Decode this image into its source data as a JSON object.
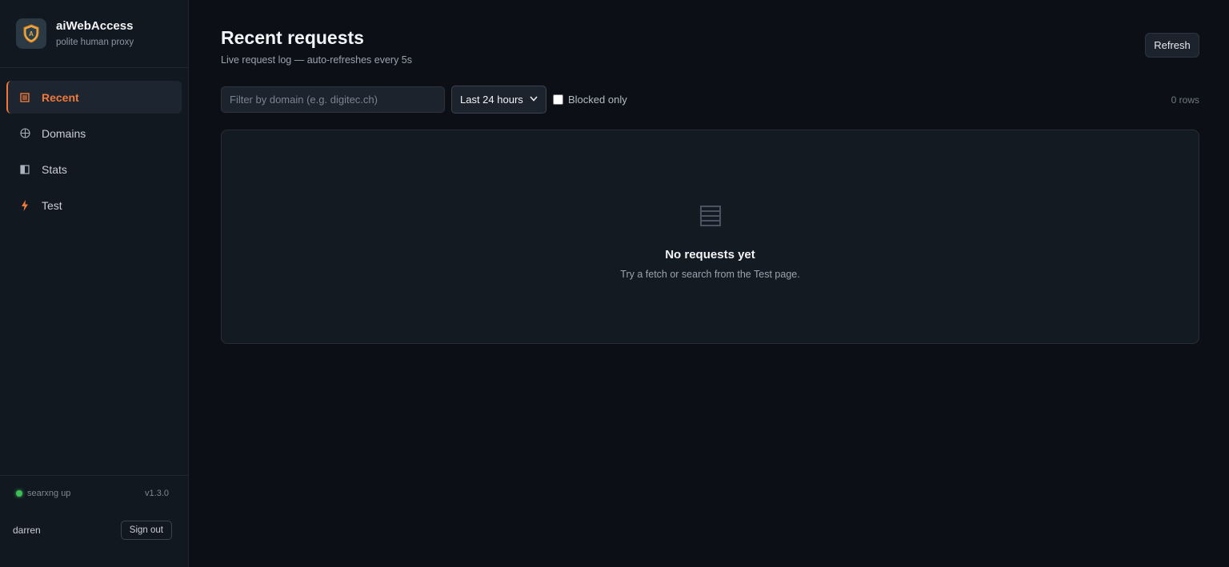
{
  "app": {
    "name": "aiWebAccess",
    "tagline": "polite human proxy"
  },
  "nav": {
    "items": [
      {
        "label": "Recent",
        "icon": "list-icon",
        "active": true
      },
      {
        "label": "Domains",
        "icon": "globe-icon",
        "active": false
      },
      {
        "label": "Stats",
        "icon": "half-square-icon",
        "active": false
      },
      {
        "label": "Test",
        "icon": "bolt-icon",
        "active": false
      }
    ]
  },
  "footer": {
    "status": "searxng up",
    "version": "v1.3.0",
    "user": "darren",
    "signout_label": "Sign out"
  },
  "page": {
    "title": "Recent requests",
    "subtitle": "Live request log — auto-refreshes every 5s",
    "refresh_label": "Refresh"
  },
  "filters": {
    "domain_placeholder": "Filter by domain (e.g. digitec.ch)",
    "domain_value": "",
    "range_selected": "Last 24 hours",
    "blocked_label": "Blocked only",
    "blocked_checked": false,
    "rows_count": "0 rows"
  },
  "empty": {
    "title": "No requests yet",
    "subtitle": "Try a fetch or search from the Test page."
  },
  "colors": {
    "accent": "#f0793a",
    "status_ok": "#3fbf5a",
    "background": "#0c1016",
    "sidebar": "#121820",
    "card": "#141a22"
  }
}
